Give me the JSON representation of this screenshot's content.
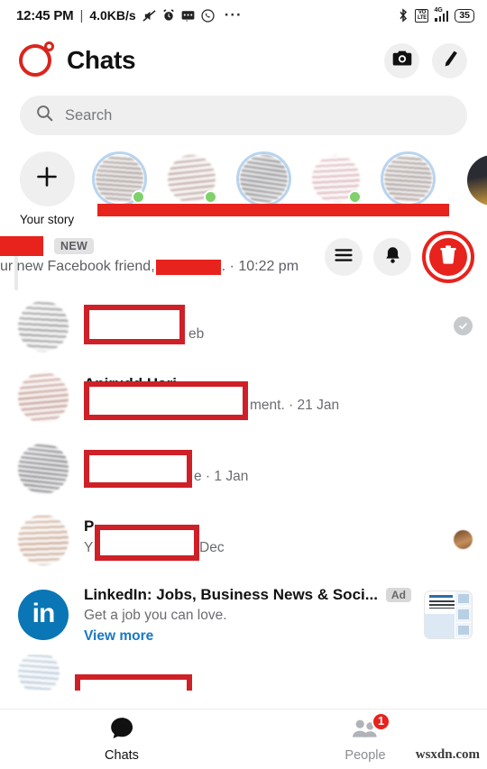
{
  "status_bar": {
    "time": "12:45 PM",
    "separator": "|",
    "data_rate": "4.0KB/s",
    "left_icons": [
      "mute-icon",
      "alarm-icon",
      "messages-icon",
      "whatsapp-icon"
    ],
    "overflow": "···",
    "right_icons": [
      "bluetooth-icon",
      "volte-icon",
      "signal-4g-icon"
    ],
    "volte_top": "VO",
    "volte_bottom": "LTE",
    "network_gen": "4G",
    "battery_level": "35"
  },
  "header": {
    "title": "Chats",
    "logo": "messenger-logo-redacted",
    "camera_label": "camera-icon",
    "compose_label": "compose-icon"
  },
  "search": {
    "placeholder": "Search",
    "icon": "search-icon"
  },
  "stories": {
    "your_story_label": "Your story",
    "add_icon": "plus-icon",
    "items": [
      {
        "redacted": true,
        "online": true,
        "ring": true
      },
      {
        "redacted": true,
        "online": true,
        "ring": false
      },
      {
        "redacted": true,
        "online": false,
        "ring": true
      },
      {
        "redacted": true,
        "online": true,
        "ring": false
      },
      {
        "redacted": true,
        "online": false,
        "ring": true
      }
    ],
    "name_bar_redacted": true
  },
  "notification": {
    "title_redacted": true,
    "badge": "NEW",
    "text_before": "ur new Facebook friend,",
    "text_after": ". · 10:22 pm",
    "overlay_actions": [
      {
        "name": "menu-icon",
        "style": "gray"
      },
      {
        "name": "bell-icon",
        "style": "gray"
      },
      {
        "name": "delete-icon",
        "style": "red-highlighted"
      }
    ]
  },
  "chats": [
    {
      "name_visible": "",
      "snippet_visible": "eb",
      "timestamp": "",
      "status": "seen-check",
      "redacted": true
    },
    {
      "name_visible": "Anirudd Hari",
      "snippet_visible": "ment. · 21 Jan",
      "timestamp": "21 Jan",
      "status": "",
      "redacted": true
    },
    {
      "name_visible": "",
      "snippet_visible": "e · 1 Jan",
      "timestamp": "1 Jan",
      "status": "",
      "redacted": true
    },
    {
      "name_visible": "P",
      "snippet_visible": "Dec",
      "snippet_prefix": "Y",
      "timestamp": "Dec",
      "status": "mini-avatar",
      "redacted": true
    }
  ],
  "ad": {
    "title": "LinkedIn: Jobs, Business News & Soci...",
    "badge": "Ad",
    "description": "Get a job you can love.",
    "cta": "View more",
    "logo_text": "in",
    "logo_color": "#0a76b5",
    "thumbnail": "linkedin-ad-thumbnail"
  },
  "bottom_nav": {
    "items": [
      {
        "label": "Chats",
        "icon": "chat-bubble-icon",
        "active": true,
        "badge": ""
      },
      {
        "label": "People",
        "icon": "people-icon",
        "active": false,
        "badge": "1"
      }
    ]
  },
  "watermark": "wsxdn.com",
  "colors": {
    "redaction_red": "#e8221c",
    "redaction_outline": "#cf2027",
    "accent_blue": "#1878c6",
    "linkedin_blue": "#0a76b5",
    "online_green": "#7fd16b",
    "chip_gray": "#efefef"
  }
}
